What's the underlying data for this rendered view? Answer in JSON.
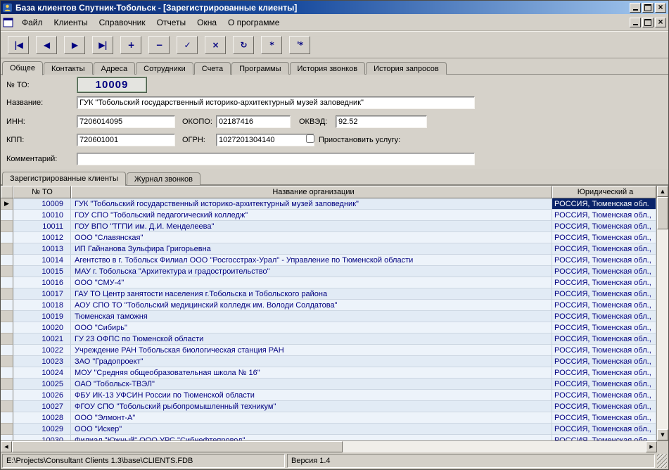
{
  "window": {
    "title": "База клиентов Спутник-Тобольск - [Зарегистрированные клиенты]"
  },
  "menu": {
    "items": [
      {
        "name": "file",
        "label": "Файл"
      },
      {
        "name": "clients",
        "label": "Клиенты"
      },
      {
        "name": "directory",
        "label": "Справочник"
      },
      {
        "name": "reports",
        "label": "Отчеты"
      },
      {
        "name": "windows",
        "label": "Окна"
      },
      {
        "name": "about",
        "label": "О программе"
      }
    ]
  },
  "toolbar": {
    "buttons": [
      {
        "name": "first",
        "glyph": "|◀"
      },
      {
        "name": "prior",
        "glyph": "◀"
      },
      {
        "name": "next",
        "glyph": "▶"
      },
      {
        "name": "last",
        "glyph": "▶|"
      },
      {
        "name": "insert",
        "glyph": "+"
      },
      {
        "name": "delete",
        "glyph": "−"
      },
      {
        "name": "post",
        "glyph": "✓"
      },
      {
        "name": "cancel",
        "glyph": "×"
      },
      {
        "name": "refresh",
        "glyph": "↻"
      },
      {
        "name": "apply-updates",
        "glyph": "*"
      },
      {
        "name": "cancel-updates",
        "glyph": "'*"
      }
    ]
  },
  "tabs_top": [
    {
      "name": "general",
      "label": "Общее",
      "active": true
    },
    {
      "name": "contacts",
      "label": "Контакты",
      "active": false
    },
    {
      "name": "addresses",
      "label": "Адреса",
      "active": false
    },
    {
      "name": "employees",
      "label": "Сотрудники",
      "active": false
    },
    {
      "name": "accounts",
      "label": "Счета",
      "active": false
    },
    {
      "name": "programs",
      "label": "Программы",
      "active": false
    },
    {
      "name": "call-history",
      "label": "История звонков",
      "active": false
    },
    {
      "name": "request-history",
      "label": "История запросов",
      "active": false
    }
  ],
  "form": {
    "no_label": "№ ТО:",
    "no_value": "10009",
    "name_label": "Название:",
    "name_value": "ГУК \"Тобольский государственный историко-архитектурный музей заповедник\"",
    "inn_label": "ИНН:",
    "inn_value": "7206014095",
    "okopo_label": "ОКОПО:",
    "okopo_value": "02187416",
    "okved_label": "ОКВЭД:",
    "okved_value": "92.52",
    "kpp_label": "КПП:",
    "kpp_value": "720601001",
    "ogrn_label": "ОГРН:",
    "ogrn_value": "1027201304140",
    "suspend_label": "Приостановить услугу:",
    "comment_label": "Комментарий:",
    "comment_value": ""
  },
  "tabs_bottom": [
    {
      "name": "registered-clients",
      "label": "Зарегистрированные клиенты",
      "active": true
    },
    {
      "name": "call-log",
      "label": "Журнал звонков",
      "active": false
    }
  ],
  "grid": {
    "columns": [
      "№ ТО",
      "Название организации",
      "Юридический а"
    ],
    "selected_index": 0,
    "rows": [
      {
        "no": "10009",
        "name": "ГУК \"Тобольский государственный историко-архитектурный музей заповедник\"",
        "legal": "РОССИЯ, Тюменская обл."
      },
      {
        "no": "10010",
        "name": "ГОУ СПО \"Тобольский педагогический колледж\"",
        "legal": "РОССИЯ, Тюменская обл.,"
      },
      {
        "no": "10011",
        "name": "ГОУ ВПО \"ТГПИ им. Д.И. Менделеева\"",
        "legal": "РОССИЯ, Тюменская обл.,"
      },
      {
        "no": "10012",
        "name": "ООО \"Славянская\"",
        "legal": "РОССИЯ, Тюменская обл.,"
      },
      {
        "no": "10013",
        "name": "ИП Гайнанова Зульфира Григорьевна",
        "legal": "РОССИЯ, Тюменская обл.,"
      },
      {
        "no": "10014",
        "name": "Агентство в г. Тобольск Филиал ООО \"Росгосстрах-Урал\" - Управление по Тюменской области",
        "legal": "РОССИЯ, Тюменская обл.,"
      },
      {
        "no": "10015",
        "name": "МАУ г. Тобольска \"Архитектура и градостроительство\"",
        "legal": "РОССИЯ, Тюменская обл.,"
      },
      {
        "no": "10016",
        "name": "ООО \"СМУ-4\"",
        "legal": "РОССИЯ, Тюменская обл.,"
      },
      {
        "no": "10017",
        "name": "ГАУ ТО Центр занятости населения г.Тобольска и Тобольского района",
        "legal": "РОССИЯ, Тюменская обл.,"
      },
      {
        "no": "10018",
        "name": "АОУ СПО ТО \"Тобольский медицинский колледж им. Володи Солдатова\"",
        "legal": "РОССИЯ, Тюменская обл.,"
      },
      {
        "no": "10019",
        "name": "Тюменская таможня",
        "legal": "РОССИЯ, Тюменская обл.,"
      },
      {
        "no": "10020",
        "name": "ООО \"Сибирь\"",
        "legal": "РОССИЯ, Тюменская обл.,"
      },
      {
        "no": "10021",
        "name": "ГУ 23 ОФПС по Тюменской области",
        "legal": "РОССИЯ, Тюменская обл.,"
      },
      {
        "no": "10022",
        "name": "Учреждение РАН Тобольская биологическая станция РАН",
        "legal": "РОССИЯ, Тюменская обл.,"
      },
      {
        "no": "10023",
        "name": "ЗАО \"Градопроект\"",
        "legal": "РОССИЯ, Тюменская обл.,"
      },
      {
        "no": "10024",
        "name": "МОУ \"Средняя общеобразовательная школа № 16\"",
        "legal": "РОССИЯ, Тюменская обл.,"
      },
      {
        "no": "10025",
        "name": "ОАО \"Тобольск-ТВЭЛ\"",
        "legal": "РОССИЯ, Тюменская обл.,"
      },
      {
        "no": "10026",
        "name": "ФБУ ИК-13 УФСИН России по Тюменской области",
        "legal": "РОССИЯ, Тюменская обл.,"
      },
      {
        "no": "10027",
        "name": "ФГОУ СПО \"Тобольский рыбопромышленный техникум\"",
        "legal": "РОССИЯ, Тюменская обл.,"
      },
      {
        "no": "10028",
        "name": "ООО \"Элмонт-А\"",
        "legal": "РОССИЯ, Тюменская обл.,"
      },
      {
        "no": "10029",
        "name": "ООО \"Искер\"",
        "legal": "РОССИЯ, Тюменская обл.,"
      },
      {
        "no": "10030",
        "name": "Филиал \"Южный\" ООО УРС \"Сибнефтепровод\"",
        "legal": "РОССИЯ, Тюменская обл.,"
      }
    ]
  },
  "statusbar": {
    "path": "E:\\Projects\\Consultant Clients 1.3\\base\\CLIENTS.FDB",
    "version": "Версия 1.4"
  }
}
